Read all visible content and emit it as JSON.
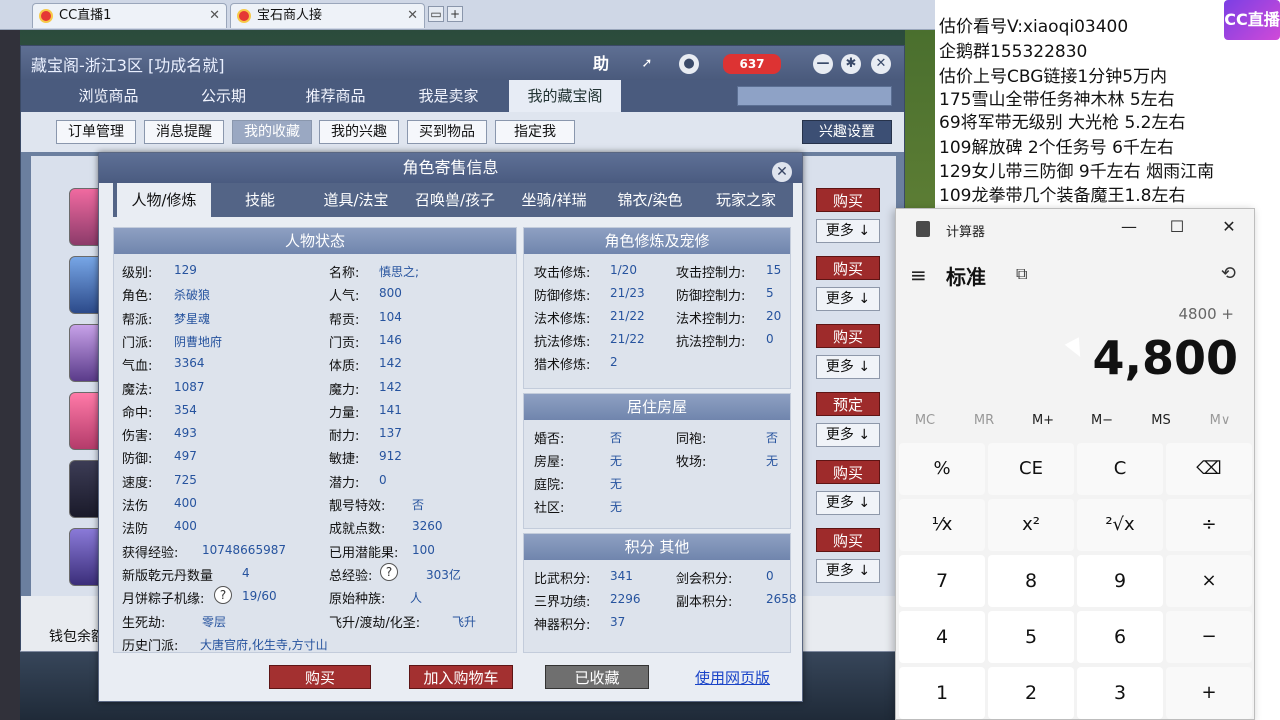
{
  "browser": {
    "tabs": [
      {
        "label": "CC直播1",
        "close": "✕"
      },
      {
        "label": "宝石商人接",
        "close": "✕"
      }
    ],
    "ctrl_restore": "▭",
    "ctrl_add": "+"
  },
  "shop": {
    "title": "藏宝阁-浙江3区 [功成名就]",
    "help_label": "助",
    "cart_count": "637",
    "nav_tabs": [
      "浏览商品",
      "公示期",
      "推荐商品",
      "我是卖家",
      "我的藏宝阁"
    ],
    "sub_buttons": [
      "订单管理",
      "消息提醒",
      "我的收藏",
      "我的兴趣",
      "买到物品",
      "指定我"
    ],
    "interest_settings": "兴趣设置",
    "rows": [
      {
        "action": "购买",
        "more": "更多 ↓"
      },
      {
        "action": "购买",
        "more": "更多 ↓"
      },
      {
        "action": "购买",
        "more": "更多 ↓"
      },
      {
        "action": "预定",
        "more": "更多 ↓"
      },
      {
        "action": "购买",
        "more": "更多 ↓"
      },
      {
        "action": "购买",
        "more": "更多 ↓"
      }
    ],
    "wallet_label": "钱包余额"
  },
  "dialog": {
    "title": "角色寄售信息",
    "close": "✕",
    "tabs": [
      "人物/修炼",
      "技能",
      "道具/法宝",
      "召唤兽/孩子",
      "坐骑/祥瑞",
      "锦衣/染色",
      "玩家之家"
    ],
    "status_header": "人物状态",
    "status_left": [
      {
        "label": "级别:",
        "value": "129"
      },
      {
        "label": "角色:",
        "value": "杀破狼"
      },
      {
        "label": "帮派:",
        "value": "梦星魂"
      },
      {
        "label": "门派:",
        "value": "阴曹地府"
      },
      {
        "label": "气血:",
        "value": "3364"
      },
      {
        "label": "魔法:",
        "value": "1087"
      },
      {
        "label": "命中:",
        "value": "354"
      },
      {
        "label": "伤害:",
        "value": "493"
      },
      {
        "label": "防御:",
        "value": "497"
      },
      {
        "label": "速度:",
        "value": "725"
      },
      {
        "label": "法伤",
        "value": "400"
      },
      {
        "label": "法防",
        "value": "400"
      },
      {
        "label": "获得经验:",
        "value": "10748665987"
      },
      {
        "label": "新版乾元丹数量",
        "value": "4"
      },
      {
        "label": "月饼粽子机缘:",
        "value": "19/60"
      },
      {
        "label": "生死劫:",
        "value": "零层"
      },
      {
        "label": "历史门派:",
        "value": "大唐官府,化生寺,方寸山"
      }
    ],
    "status_right": [
      {
        "label": "名称:",
        "value": "慎思之;"
      },
      {
        "label": "人气:",
        "value": "800"
      },
      {
        "label": "帮贡:",
        "value": "104"
      },
      {
        "label": "门贡:",
        "value": "146"
      },
      {
        "label": "体质:",
        "value": "142"
      },
      {
        "label": "魔力:",
        "value": "142"
      },
      {
        "label": "力量:",
        "value": "141"
      },
      {
        "label": "耐力:",
        "value": "137"
      },
      {
        "label": "敏捷:",
        "value": "912"
      },
      {
        "label": "潜力:",
        "value": "0"
      },
      {
        "label": "靓号特效:",
        "value": "否"
      },
      {
        "label": "成就点数:",
        "value": "3260"
      },
      {
        "label": "已用潜能果:",
        "value": "100"
      },
      {
        "label": "总经验:",
        "value": "303亿"
      },
      {
        "label": "原始种族:",
        "value": "人"
      },
      {
        "label": "飞升/渡劫/化圣:",
        "value": "飞升"
      }
    ],
    "help_q": "?",
    "cultivation_header": "角色修炼及宠修",
    "cultivation": [
      {
        "label": "攻击修炼:",
        "value": "1/20",
        "label2": "攻击控制力:",
        "value2": "15"
      },
      {
        "label": "防御修炼:",
        "value": "21/23",
        "label2": "防御控制力:",
        "value2": "5"
      },
      {
        "label": "法术修炼:",
        "value": "21/22",
        "label2": "法术控制力:",
        "value2": "20"
      },
      {
        "label": "抗法修炼:",
        "value": "21/22",
        "label2": "抗法控制力:",
        "value2": "0"
      },
      {
        "label": "猎术修炼:",
        "value": "2",
        "label2": "",
        "value2": ""
      }
    ],
    "house_header": "居住房屋",
    "house": [
      {
        "label": "婚否:",
        "value": "否",
        "label2": "同袍:",
        "value2": "否"
      },
      {
        "label": "房屋:",
        "value": "无",
        "label2": "牧场:",
        "value2": "无"
      },
      {
        "label": "庭院:",
        "value": "无",
        "label2": "",
        "value2": ""
      },
      {
        "label": "社区:",
        "value": "无",
        "label2": "",
        "value2": ""
      }
    ],
    "points_header": "积分 其他",
    "points": [
      {
        "label": "比武积分:",
        "value": "341",
        "label2": "剑会积分:",
        "value2": "0"
      },
      {
        "label": "三界功绩:",
        "value": "2296",
        "label2": "副本积分:",
        "value2": "2658"
      },
      {
        "label": "神器积分:",
        "value": "37",
        "label2": "",
        "value2": ""
      }
    ],
    "buttons": {
      "buy": "购买",
      "add_cart": "加入购物车",
      "favorited": "已收藏",
      "web": "使用网页版"
    }
  },
  "overlay": {
    "lines": [
      "估价看号V:xiaoqi03400",
      "企鹅群155322830",
      "估价上号CBG链接1分钟5万内",
      "175雪山全带任务神木林 5左右",
      "69将军带无级别 大光枪 5.2左右",
      "109解放碑 2个任务号 6千左右",
      "129女儿带三防御 9千左右 烟雨江南",
      "109龙拳带几个装备魔王1.8左右"
    ],
    "logo": "CC直播"
  },
  "calculator": {
    "title": "计算器",
    "mode": "标准",
    "expression": "4800 +",
    "display": "4,800",
    "min": "—",
    "max": "☐",
    "close": "✕",
    "memory": [
      "MC",
      "MR",
      "M+",
      "M−",
      "MS",
      "M∨"
    ],
    "keys": [
      [
        "%",
        "CE",
        "C",
        "⌫"
      ],
      [
        "¹⁄x",
        "x²",
        "²√x",
        "÷"
      ],
      [
        "7",
        "8",
        "9",
        "×"
      ],
      [
        "4",
        "5",
        "6",
        "−"
      ],
      [
        "1",
        "2",
        "3",
        "+"
      ]
    ]
  }
}
